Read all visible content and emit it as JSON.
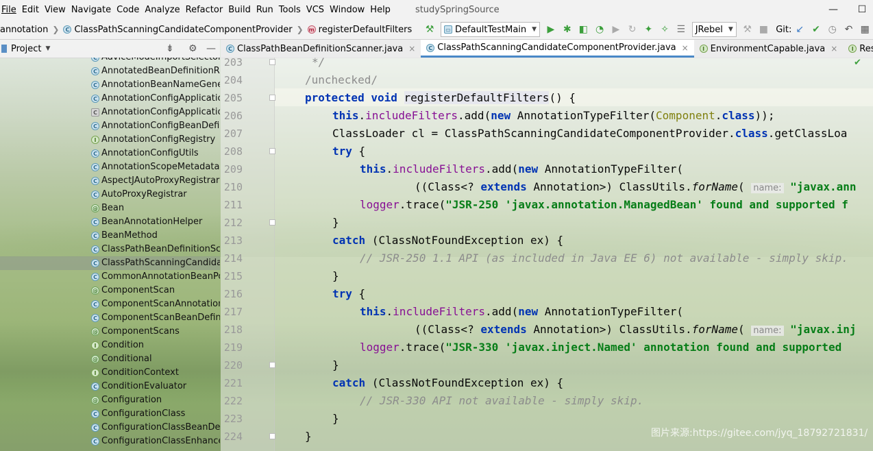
{
  "menu": [
    "File",
    "Edit",
    "View",
    "Navigate",
    "Code",
    "Analyze",
    "Refactor",
    "Build",
    "Run",
    "Tools",
    "VCS",
    "Window",
    "Help"
  ],
  "window_title": "studySpringSource",
  "window_controls": {
    "minimize": "—",
    "maximize": "☐"
  },
  "breadcrumb": {
    "pkg": "annotation",
    "cls": "ClassPathScanningCandidateComponentProvider",
    "method": "registerDefaultFilters"
  },
  "toolbar": {
    "run_config": "DefaultTestMain",
    "jrebel": "JRebel",
    "git_label": "Git:"
  },
  "project": {
    "title": "Project",
    "items": [
      {
        "label": "AdviceModeImportSelector",
        "icon": "class-icon",
        "glyph": "C",
        "kind": "ic-class"
      },
      {
        "label": "AnnotatedBeanDefinitionReader",
        "icon": "class-icon",
        "glyph": "C",
        "kind": "ic-class"
      },
      {
        "label": "AnnotationBeanNameGenerator",
        "icon": "class-icon",
        "glyph": "C",
        "kind": "ic-class"
      },
      {
        "label": "AnnotationConfigApplicationContext",
        "icon": "class-icon",
        "glyph": "C",
        "kind": "ic-class"
      },
      {
        "label": "AnnotationConfigApplicationContextUtils",
        "icon": "abstract-class-icon",
        "glyph": "C",
        "kind": "ic-abstract"
      },
      {
        "label": "AnnotationConfigBeanDefinitionParser",
        "icon": "class-icon",
        "glyph": "C",
        "kind": "ic-class"
      },
      {
        "label": "AnnotationConfigRegistry",
        "icon": "interface-icon",
        "glyph": "I",
        "kind": "ic-iface"
      },
      {
        "label": "AnnotationConfigUtils",
        "icon": "class-icon",
        "glyph": "C",
        "kind": "ic-class"
      },
      {
        "label": "AnnotationScopeMetadataResolver",
        "icon": "class-icon",
        "glyph": "C",
        "kind": "ic-class"
      },
      {
        "label": "AspectJAutoProxyRegistrar",
        "icon": "class-icon",
        "glyph": "C",
        "kind": "ic-class"
      },
      {
        "label": "AutoProxyRegistrar",
        "icon": "class-icon",
        "glyph": "C",
        "kind": "ic-class"
      },
      {
        "label": "Bean",
        "icon": "annotation-icon",
        "glyph": "@",
        "kind": "ic-annot"
      },
      {
        "label": "BeanAnnotationHelper",
        "icon": "class-icon",
        "glyph": "C",
        "kind": "ic-class"
      },
      {
        "label": "BeanMethod",
        "icon": "class-icon",
        "glyph": "C",
        "kind": "ic-class"
      },
      {
        "label": "ClassPathBeanDefinitionScanner",
        "icon": "class-icon",
        "glyph": "C",
        "kind": "ic-class"
      },
      {
        "label": "ClassPathScanningCandidateComponentProvider",
        "icon": "class-icon",
        "glyph": "C",
        "kind": "ic-class",
        "selected": true
      },
      {
        "label": "CommonAnnotationBeanPostProcessor",
        "icon": "class-icon",
        "glyph": "C",
        "kind": "ic-class"
      },
      {
        "label": "ComponentScan",
        "icon": "annotation-icon",
        "glyph": "@",
        "kind": "ic-annot"
      },
      {
        "label": "ComponentScanAnnotationParser",
        "icon": "class-icon",
        "glyph": "C",
        "kind": "ic-class"
      },
      {
        "label": "ComponentScanBeanDefinitionParser",
        "icon": "class-icon",
        "glyph": "C",
        "kind": "ic-class"
      },
      {
        "label": "ComponentScans",
        "icon": "annotation-icon",
        "glyph": "@",
        "kind": "ic-annot"
      },
      {
        "label": "Condition",
        "icon": "interface-icon",
        "glyph": "I",
        "kind": "ic-iface"
      },
      {
        "label": "Conditional",
        "icon": "annotation-icon",
        "glyph": "@",
        "kind": "ic-annot"
      },
      {
        "label": "ConditionContext",
        "icon": "interface-icon",
        "glyph": "I",
        "kind": "ic-iface"
      },
      {
        "label": "ConditionEvaluator",
        "icon": "class-icon",
        "glyph": "C",
        "kind": "ic-class"
      },
      {
        "label": "Configuration",
        "icon": "annotation-icon",
        "glyph": "@",
        "kind": "ic-annot"
      },
      {
        "label": "ConfigurationClass",
        "icon": "class-icon",
        "glyph": "C",
        "kind": "ic-class"
      },
      {
        "label": "ConfigurationClassBeanDefinitionReader",
        "icon": "class-icon",
        "glyph": "C",
        "kind": "ic-class"
      },
      {
        "label": "ConfigurationClassEnhancer",
        "icon": "class-icon",
        "glyph": "C",
        "kind": "ic-class"
      }
    ]
  },
  "tabs": [
    {
      "label": "ClassPathBeanDefinitionScanner.java",
      "glyph": "C",
      "kind": "ic-class",
      "active": false
    },
    {
      "label": "ClassPathScanningCandidateComponentProvider.java",
      "glyph": "C",
      "kind": "ic-class",
      "active": true
    },
    {
      "label": "EnvironmentCapable.java",
      "glyph": "I",
      "kind": "ic-iface",
      "active": false
    },
    {
      "label": "ResourceLoaderAwa",
      "glyph": "I",
      "kind": "ic-iface",
      "active": false
    }
  ],
  "line_numbers": [
    "203",
    "204",
    "205",
    "206",
    "207",
    "208",
    "209",
    "210",
    "211",
    "212",
    "213",
    "214",
    "215",
    "216",
    "217",
    "218",
    "219",
    "220",
    "221",
    "222",
    "223",
    "224"
  ],
  "code": {
    "l203": "*/",
    "l204": "/unchecked/",
    "l205_kw1": "protected",
    "l205_kw2": "void",
    "l205_name": "registerDefaultFilters",
    "l205_rest": "() {",
    "this": "this",
    "new": "new",
    "class_kw": "class",
    "try": "try",
    "catch": "catch",
    "extends": "extends",
    "includeFilters": "includeFilters",
    "logger": "logger",
    "l206_a": ".add(",
    "l206_b": " AnnotationTypeFilter(",
    "l206_c": "Component",
    "l206_d": "));",
    "l207_a": "ClassLoader cl = ClassPathScanningCandidateComponentProvider.",
    "l207_b": ".getClassLoa",
    "open_brace": " {",
    "close_brace": "}",
    "add_new_atf": ".add(",
    "atf_open": " AnnotationTypeFilter(",
    "cast_a": "((Class<? ",
    "cast_b": " Annotation>) ClassUtils.",
    "forName": "forName",
    "forName_paren": "( ",
    "hint_name": "name:",
    "str_210": " \"javax.ann",
    "str_218": " \"javax.inj",
    "trace": ".trace(",
    "str_211": "\"JSR-250 'javax.annotation.ManagedBean' found and supported f",
    "str_219": "\"JSR-330 'javax.inject.Named' annotation found and supported ",
    "catch_rest": " (ClassNotFoundException ex) {",
    "cmt_214": "// JSR-250 1.1 API (as included in Java EE 6) not available - simply skip.",
    "cmt_222": "// JSR-330 API not available - simply skip."
  },
  "watermark": "图片来源:https://gitee.com/jyq_18792721831/"
}
